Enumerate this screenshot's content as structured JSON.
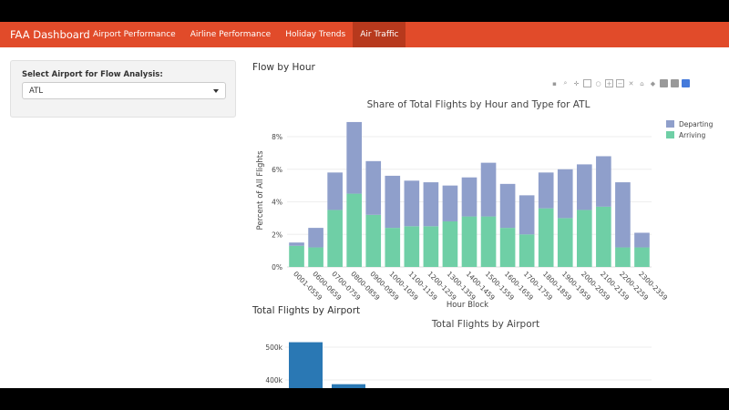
{
  "nav": {
    "brand": "FAA Dashboard",
    "items": [
      {
        "label": "Airport Performance",
        "active": false
      },
      {
        "label": "Airline Performance",
        "active": false
      },
      {
        "label": "Holiday Trends",
        "active": false
      },
      {
        "label": "Air Traffic",
        "active": true
      }
    ]
  },
  "sidebar": {
    "select_label": "Select Airport for Flow Analysis:",
    "selected_airport": "ATL"
  },
  "sections": {
    "flow_title": "Flow by Hour",
    "airport_title": "Total Flights by Airport"
  },
  "modebar_icons": [
    "camera-icon",
    "zoom-icon",
    "pan-icon",
    "box-select-icon",
    "lasso-icon",
    "zoom-in-icon",
    "zoom-out-icon",
    "autoscale-icon",
    "reset-axes-icon",
    "spike-lines-icon",
    "hover-closest-icon",
    "hover-compare-icon",
    "plotly-logo-icon"
  ],
  "colors": {
    "navbar": "#e14b2a",
    "navbar_active": "#b7391d",
    "departing": "#8f9fcb",
    "arriving": "#6fcfa6",
    "airport_bar": "#2a78b4"
  },
  "chart_data": [
    {
      "type": "bar",
      "stacked": true,
      "title": "Share of Total Flights by Hour and Type for ATL",
      "xlabel": "Hour Block",
      "ylabel": "Percent of All Flights",
      "categories": [
        "0001-0559",
        "0600-0659",
        "0700-0759",
        "0800-0859",
        "0900-0959",
        "1000-1059",
        "1100-1159",
        "1200-1259",
        "1300-1359",
        "1400-1459",
        "1500-1559",
        "1600-1659",
        "1700-1759",
        "1800-1859",
        "1900-1959",
        "2000-2059",
        "2100-2159",
        "2200-2259",
        "2300-2359"
      ],
      "series": [
        {
          "name": "Arriving",
          "values": [
            1.3,
            1.2,
            3.5,
            4.5,
            3.2,
            2.4,
            2.5,
            2.5,
            2.8,
            3.1,
            3.1,
            2.4,
            2.0,
            3.6,
            3.0,
            3.5,
            3.7,
            1.2,
            1.2
          ]
        },
        {
          "name": "Departing",
          "values": [
            0.2,
            1.2,
            2.3,
            4.4,
            3.3,
            3.2,
            2.8,
            2.7,
            2.2,
            2.4,
            3.3,
            2.7,
            2.4,
            2.2,
            3.0,
            2.8,
            3.1,
            4.0,
            0.9
          ]
        }
      ],
      "yticks": [
        "0%",
        "2%",
        "4%",
        "6%",
        "8%"
      ],
      "ylim": [
        0,
        9.4
      ],
      "legend": [
        "Departing",
        "Arriving"
      ],
      "legend_position": "top-right",
      "grid": true
    },
    {
      "type": "bar",
      "title": "Total Flights by Airport",
      "yticks": [
        "400k",
        "500k"
      ],
      "values": [
        515000,
        387000
      ],
      "grid": true
    }
  ]
}
